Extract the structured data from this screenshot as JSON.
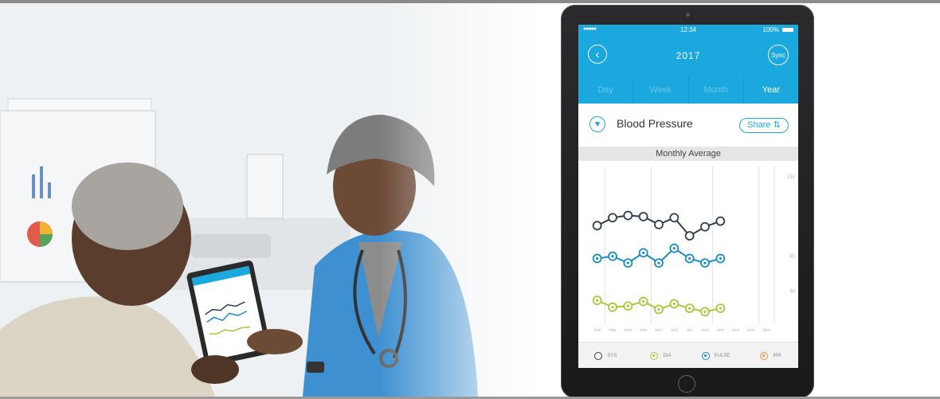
{
  "status_bar": {
    "signal": "●●●●●",
    "time": "12:34",
    "battery": "100%"
  },
  "header": {
    "year": "2017",
    "sync_label": "Sync"
  },
  "tabs": [
    {
      "label": "Day",
      "active": false
    },
    {
      "label": "Week",
      "active": false
    },
    {
      "label": "Month",
      "active": false
    },
    {
      "label": "Year",
      "active": true
    }
  ],
  "section": {
    "title": "Blood Pressure",
    "share_label": "Share ⇅"
  },
  "chart_data": {
    "type": "line",
    "title": "Monthly Average",
    "categories": [
      "JAN",
      "FEB",
      "MAR",
      "APR",
      "MAY",
      "JUN",
      "JUL",
      "AUG",
      "SEP",
      "OCT",
      "NOV",
      "DEC"
    ],
    "y_ticks": [
      "151",
      "81",
      "50"
    ],
    "ylim": [
      20,
      160
    ],
    "series": [
      {
        "name": "SYS",
        "color": "#2e3f50",
        "values": [
          107,
          114,
          116,
          115,
          108,
          114,
          98,
          106,
          111
        ]
      },
      {
        "name": "DIA",
        "color": "#a6c83a",
        "values": [
          41,
          35,
          36,
          40,
          33,
          38,
          34,
          31,
          34
        ]
      },
      {
        "name": "PULSE",
        "color": "#1a8cc2",
        "values": [
          78,
          80,
          74,
          83,
          74,
          87,
          78,
          74,
          78
        ]
      }
    ]
  },
  "legend": [
    {
      "label": "SYS",
      "kind": "sys"
    },
    {
      "label": "DIA",
      "kind": "dia"
    },
    {
      "label": "PULSE",
      "kind": "pulse"
    },
    {
      "label": "IRR",
      "kind": "irr"
    }
  ]
}
